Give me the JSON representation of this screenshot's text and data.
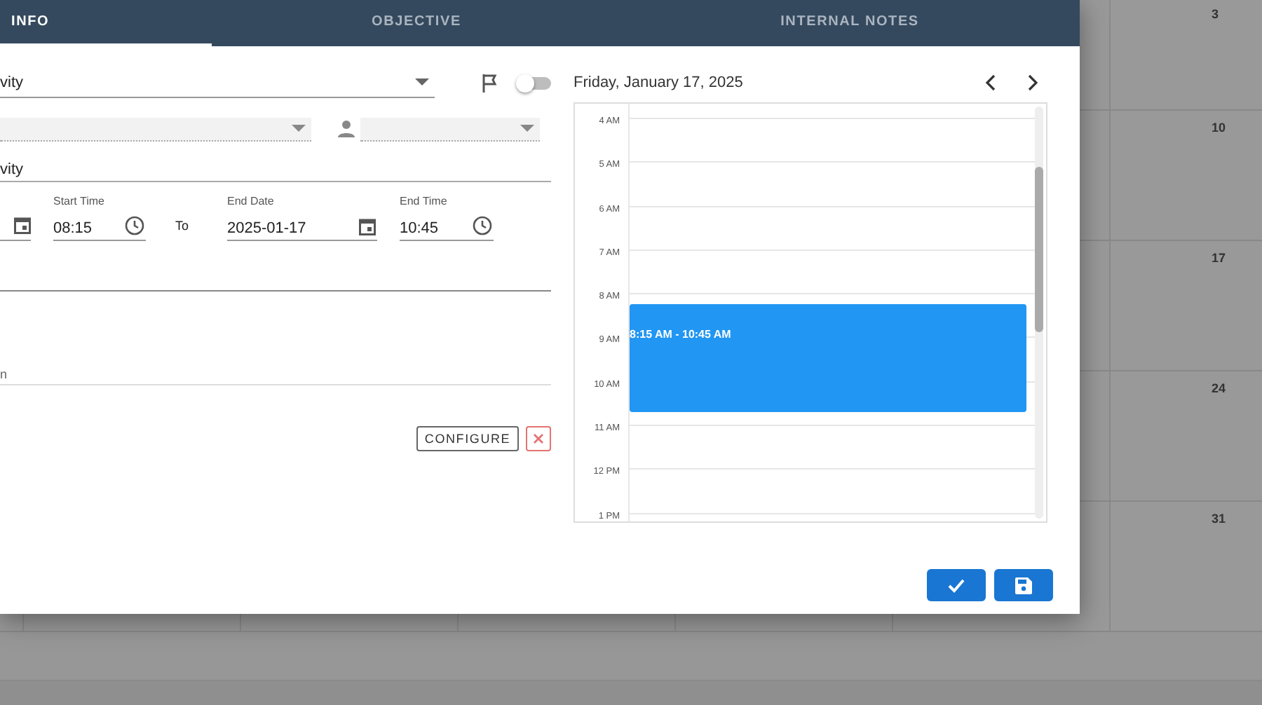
{
  "tabs": [
    {
      "label": "INFO",
      "selected": true
    },
    {
      "label": "OBJECTIVE",
      "selected": false
    },
    {
      "label": "INTERNAL NOTES",
      "selected": false
    }
  ],
  "form": {
    "type_select": {
      "value": "vity"
    },
    "flag_toggle": {
      "on": false
    },
    "title_field": {
      "value": "vity"
    },
    "start_time": {
      "label": "Start Time",
      "value": "08:15"
    },
    "to_label": "To",
    "end_date": {
      "label": "End Date",
      "value": "2025-01-17"
    },
    "end_time": {
      "label": "End Time",
      "value": "10:45"
    },
    "location_field": {
      "value": "n"
    },
    "configure_button": "CONFIGURE"
  },
  "calendar": {
    "date_title": "Friday, January 17, 2025",
    "hours": [
      "4 AM",
      "5 AM",
      "6 AM",
      "7 AM",
      "8 AM",
      "9 AM",
      "10 AM",
      "11 AM",
      "12 PM",
      "1 PM"
    ],
    "event": {
      "time": "8:15 AM - 10:45 AM"
    }
  },
  "background_calendar": {
    "days": [
      "3",
      "10",
      "17",
      "24",
      "31"
    ]
  }
}
